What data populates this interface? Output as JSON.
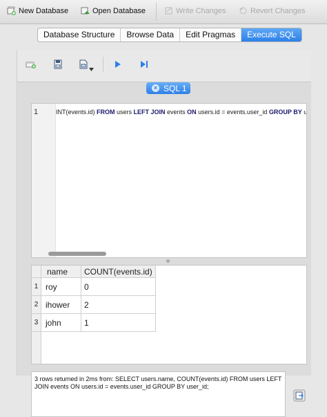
{
  "toolbar": {
    "new_database": "New Database",
    "open_database": "Open Database",
    "write_changes": "Write Changes",
    "revert_changes": "Revert Changes"
  },
  "tabs": [
    "Database Structure",
    "Browse Data",
    "Edit Pragmas",
    "Execute SQL"
  ],
  "active_tab": "Execute SQL",
  "sql_tab": {
    "label": "SQL 1"
  },
  "editor": {
    "line_number": "1",
    "code_parts": [
      "INT(events.id) ",
      "FROM",
      " users ",
      "LEFT JOIN",
      " events ",
      "ON",
      " users.id = events.user_id ",
      "GROUP BY",
      " user_id"
    ]
  },
  "results": {
    "columns": [
      "name",
      "COUNT(events.id)"
    ],
    "rows": [
      {
        "num": "1",
        "name": "roy",
        "count": "0"
      },
      {
        "num": "2",
        "name": "ihower",
        "count": "2"
      },
      {
        "num": "3",
        "name": "john",
        "count": "1"
      }
    ]
  },
  "status_message": "3 rows returned in 2ms from: SELECT users.name, COUNT(events.id) FROM users LEFT JOIN events ON users.id = events.user_id GROUP BY user_id;",
  "icons": [
    "new-database-icon",
    "open-database-icon",
    "write-changes-icon",
    "revert-changes-icon",
    "open-tab-icon",
    "open-sql-file-icon",
    "save-sql-file-icon",
    "execute-all-icon",
    "execute-line-icon",
    "close-tab-icon",
    "export-results-icon"
  ],
  "colors": {
    "accent": "#2d80e8",
    "toolbar_bg": "#e3e3e3",
    "panel_bg": "#dcdcdc"
  }
}
